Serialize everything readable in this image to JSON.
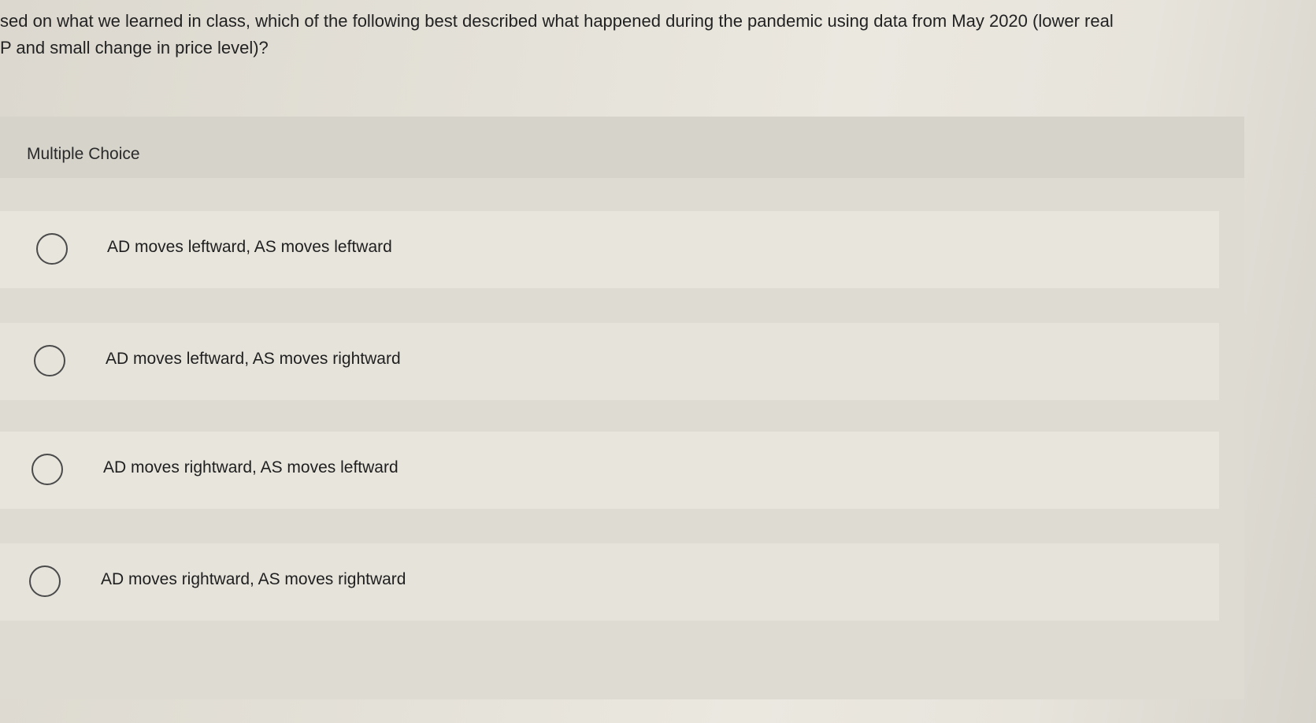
{
  "question": {
    "line1": "sed on what we learned in class, which of the following best described what happened during the pandemic using data from May 2020 (lower real",
    "line2": "P and small change in price level)?"
  },
  "panel": {
    "type_label": "Multiple Choice"
  },
  "options": [
    {
      "label": "AD moves leftward, AS moves leftward"
    },
    {
      "label": "AD moves leftward, AS moves rightward"
    },
    {
      "label": "AD moves rightward, AS moves leftward"
    },
    {
      "label": "AD moves rightward, AS moves rightward"
    }
  ]
}
